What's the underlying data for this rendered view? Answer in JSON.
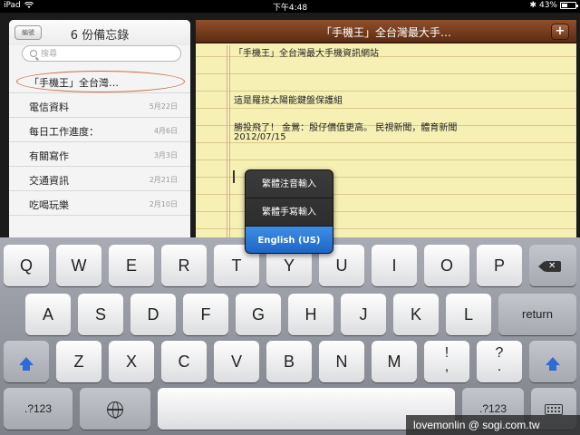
{
  "status": {
    "carrier": "iPad",
    "time": "下午4:48",
    "battery": "43%",
    "battery_level": 0.43
  },
  "sidebar": {
    "edit_label": "編號",
    "title": "6 份備忘錄",
    "search_placeholder": "搜尋",
    "notes": [
      {
        "title": "「手機王」全台灣…",
        "date": ""
      },
      {
        "title": "電信資料",
        "date": "5月22日"
      },
      {
        "title": "每日工作進度：",
        "date": "4月6日"
      },
      {
        "title": "有關寫作",
        "date": "3月3日"
      },
      {
        "title": "交通資訊",
        "date": "2月21日"
      },
      {
        "title": "吃喝玩樂",
        "date": "2月10日"
      }
    ]
  },
  "note": {
    "title": "「手機王」全台灣最大手…",
    "add_label": "+",
    "lines": [
      "「手機王」全台灣最大手機資訊網站",
      "這是羅技太陽能鍵盤保護組",
      "勝投飛了！  金鶯：殷仔價值更高。 民視新聞，體育新聞",
      "2012/07/15"
    ]
  },
  "input_menu": {
    "items": [
      {
        "label": "繁體注音輸入"
      },
      {
        "label": "繁體手寫輸入"
      },
      {
        "label": "English (US)",
        "selected": true
      }
    ]
  },
  "keyboard": {
    "row1": [
      "Q",
      "W",
      "E",
      "R",
      "T",
      "Y",
      "U",
      "I",
      "O",
      "P"
    ],
    "row2": [
      "A",
      "S",
      "D",
      "F",
      "G",
      "H",
      "J",
      "K",
      "L"
    ],
    "row3": [
      "Z",
      "X",
      "C",
      "V",
      "B",
      "N",
      "M"
    ],
    "punct1_top": "!",
    "punct1_bottom": ",",
    "punct2_top": "?",
    "punct2_bottom": ".",
    "return_label": "return",
    "numbers_label": ".?123"
  },
  "watermark": "lovemonlin  @ sogi.com.tw"
}
